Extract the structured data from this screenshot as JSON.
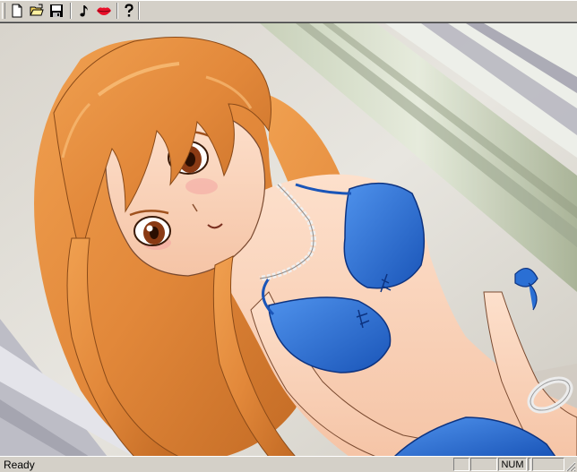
{
  "toolbar": {
    "buttons": [
      {
        "name": "new",
        "icon": "new-document-icon"
      },
      {
        "name": "open",
        "icon": "open-folder-icon"
      },
      {
        "name": "save",
        "icon": "save-disk-icon"
      },
      {
        "name": "music",
        "icon": "music-note-icon"
      },
      {
        "name": "voice",
        "icon": "lips-icon"
      },
      {
        "name": "help",
        "icon": "help-question-icon"
      }
    ]
  },
  "viewer": {
    "content": "anime-illustration"
  },
  "statusbar": {
    "text": "Ready",
    "panes": [
      "",
      "",
      "NUM",
      "",
      ""
    ]
  },
  "colors": {
    "chrome": "#d4d0c8",
    "hair": "#e08a3c",
    "bikini": "#2a6fd4",
    "skin": "#fbd6c0"
  }
}
